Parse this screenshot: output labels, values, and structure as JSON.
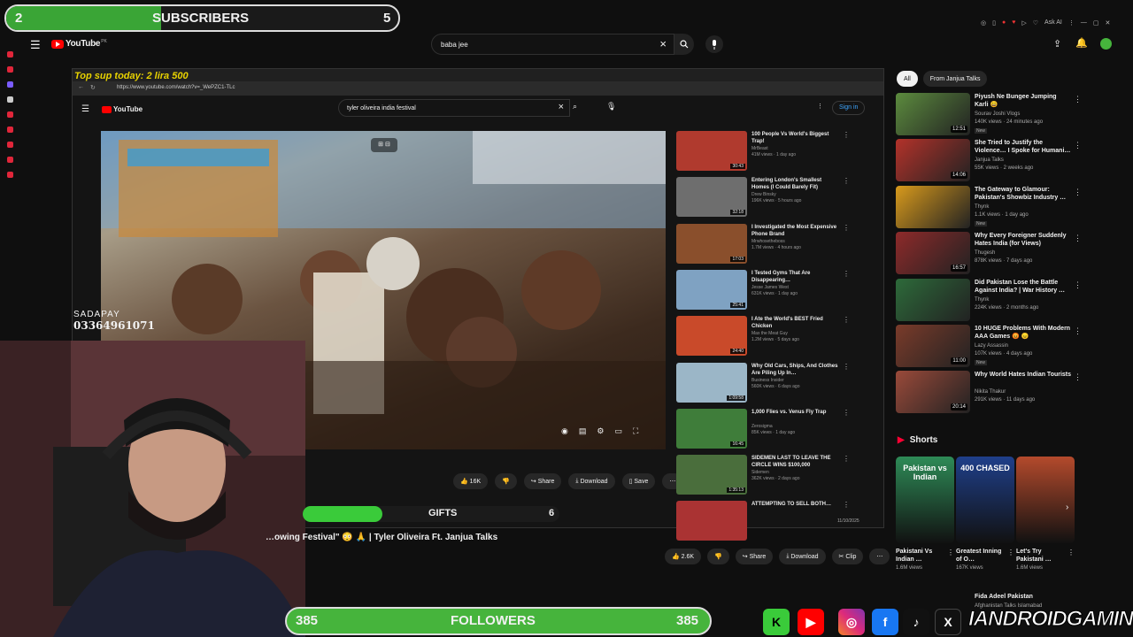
{
  "overlay": {
    "subs_left": "2",
    "subs_label": "SUBSCRIBERS",
    "subs_right": "5",
    "followers_left": "385",
    "followers_label": "FOLLOWERS",
    "followers_right": "385",
    "gifts_label": "GIFTS",
    "gifts_count": "6",
    "sadapay_label": "SADAPAY",
    "sadapay_number": "03364961071",
    "brand": "IANDROIDGAMING",
    "popup": "Top sup today: 2 lira 500"
  },
  "youtube": {
    "logo": "YouTube",
    "logo_sup": "PK",
    "search_value": "baba jee",
    "ask_ai": "Ask AI",
    "chips": [
      "All",
      "From Janjua Talks"
    ],
    "title": "…owing Festival\" 😳 🙏 | Tyler Oliveira Ft. Janjua Talks",
    "actions": {
      "likes": "2.6K",
      "share": "Share",
      "download": "Download",
      "clip": "Clip"
    },
    "shorts_title": "Shorts"
  },
  "inner": {
    "url": "https://www.youtube.com/watch?v=_WePZC1-TLc",
    "logo": "YouTube",
    "search_value": "tyler oliveira india festival",
    "signin": "Sign in",
    "likes": "16K",
    "share": "Share",
    "download": "Download",
    "save": "Save",
    "date": "11/10/2025",
    "videos": [
      {
        "title": "100 People Vs World's Biggest Trap!",
        "channel": "MrBeast",
        "meta": "41M views · 1 day ago",
        "duration": "30:43",
        "color": "#b03a2e"
      },
      {
        "title": "Entering London's Smallest Homes (I Could Barely Fit)",
        "channel": "Drew Binsky",
        "meta": "196K views · 5 hours ago",
        "duration": "32:18",
        "color": "#6e6e6e"
      },
      {
        "title": "I Investigated the Most Expensive Phone Brand",
        "channel": "Mrwhosetheboss",
        "meta": "1.7M views · 4 hours ago",
        "duration": "17:03",
        "color": "#8a4f2c"
      },
      {
        "title": "I Tested Gyms That Are Disappearing…",
        "channel": "Jesse James West",
        "meta": "631K views · 1 day ago",
        "duration": "25:41",
        "color": "#7fa2c2"
      },
      {
        "title": "I Ate the World's BEST Fried Chicken",
        "channel": "Max the Meat Guy",
        "meta": "1.2M views · 5 days ago",
        "duration": "24:40",
        "color": "#c94a2a"
      },
      {
        "title": "Why Old Cars, Ships, And Clothes Are Piling Up In…",
        "channel": "Business Insider",
        "meta": "560K views · 6 days ago",
        "duration": "1:09:58",
        "color": "#9bb6c7"
      },
      {
        "title": "1,000 Flies vs. Venus Fly Trap",
        "channel": "Zerosigma",
        "meta": "85K views · 1 day ago",
        "duration": "16:45",
        "color": "#3f7d3a"
      },
      {
        "title": "SIDEMEN LAST TO LEAVE THE CIRCLE WINS $100,000",
        "channel": "Sidemen",
        "meta": "362K views · 2 days ago",
        "duration": "1:35:13",
        "color": "#4a6e3c"
      },
      {
        "title": "ATTEMPTING TO SELL BOTH…",
        "channel": "",
        "meta": "",
        "duration": "",
        "color": "#a33"
      }
    ]
  },
  "related": [
    {
      "title": "Piyush Ne Bungee Jumping Karli 😄",
      "channel": "Sourav Joshi Vlogs",
      "meta": "140K views · 24 minutes ago",
      "badge": "New",
      "duration": "12:51",
      "color": "#5c8b3e"
    },
    {
      "title": "She Tried to Justify the Violence… I Spoke for Humani…",
      "channel": "Janjua Talks",
      "meta": "55K views · 2 weeks ago",
      "badge": "",
      "duration": "14:06",
      "color": "#b3322a"
    },
    {
      "title": "The Gateway to Glamour: Pakistan's Showbiz Industry …",
      "channel": "Thynk",
      "meta": "1.1K views · 1 day ago",
      "badge": "New",
      "duration": "",
      "color": "#d89a1c"
    },
    {
      "title": "Why Every Foreigner Suddenly Hates India (for Views)",
      "channel": "Thugesh",
      "meta": "878K views · 7 days ago",
      "badge": "",
      "duration": "16:57",
      "color": "#8e2a2a"
    },
    {
      "title": "Did Pakistan Lose the Battle Against India? | War History …",
      "channel": "Thynk",
      "meta": "224K views · 2 months ago",
      "badge": "",
      "duration": "",
      "color": "#2d6a3a"
    },
    {
      "title": "10 HUGE Problems With Modern AAA Games 😡 😠",
      "channel": "Lazy Assassin",
      "meta": "107K views · 4 days ago",
      "badge": "New",
      "duration": "11:00",
      "color": "#7a3b2a"
    },
    {
      "title": "Why World Hates Indian Tourists",
      "channel": "Nikita Thakur",
      "meta": "291K views · 11 days ago",
      "badge": "",
      "duration": "20:14",
      "color": "#9a4a3a"
    }
  ],
  "shorts": [
    {
      "title": "Pakistani Vs Indian …",
      "views": "1.6M views",
      "color": "#2e8b57",
      "overlay": "Pakistan vs Indian"
    },
    {
      "title": "Greatest Inning of O…",
      "views": "167K views",
      "color": "#1f3f8a",
      "overlay": "400 CHASED"
    },
    {
      "title": "Let's Try Pakistani …",
      "views": "1.6M views",
      "color": "#b44a2c",
      "overlay": ""
    }
  ],
  "bottom_item": {
    "title": "Fida Adeel Pakistan",
    "subtitle": "Afghanistan Talks Islamabad"
  },
  "colors": {
    "accent": "#3aa536",
    "youtube_red": "#ff0000",
    "followers_bg": "#46b43c"
  }
}
